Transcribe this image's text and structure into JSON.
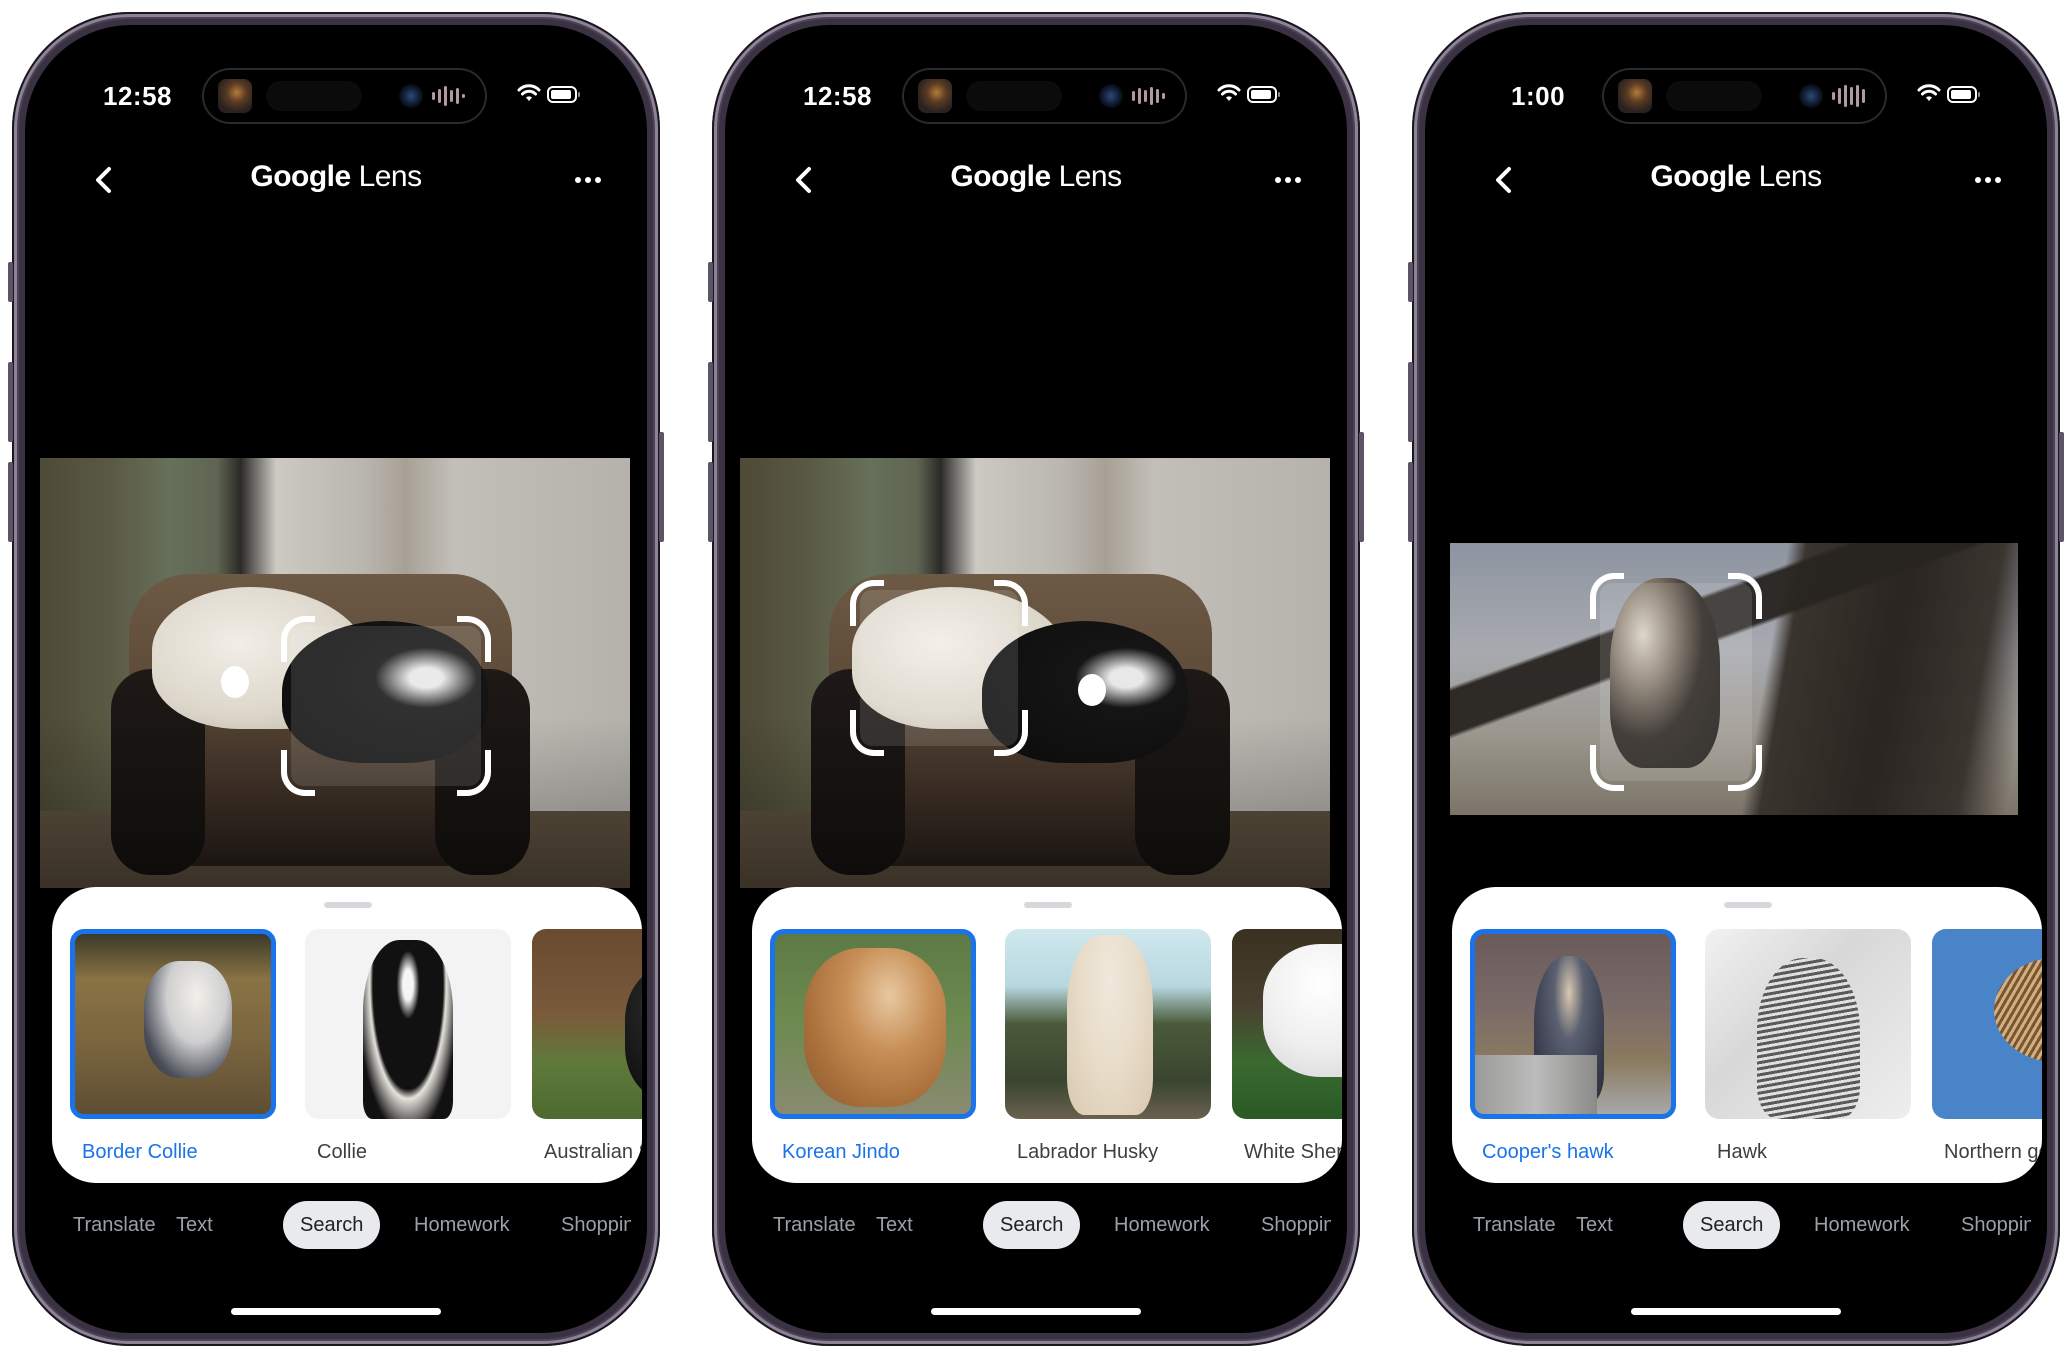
{
  "phones": [
    {
      "status": {
        "time": "12:58"
      },
      "header": {
        "title_google": "Google",
        "title_lens": "Lens",
        "back_icon": "chevron-left-icon",
        "more_icon": "more-horizontal-icon"
      },
      "photo": {
        "subject": "two dogs on a couch",
        "selected_object": "black and white dog"
      },
      "results": [
        {
          "label": "Border Collie",
          "selected": true
        },
        {
          "label": "Collie",
          "selected": false
        },
        {
          "label": "Australian Shepherd",
          "selected": false
        }
      ],
      "tabs": [
        "Translate",
        "Text",
        "Search",
        "Homework",
        "Shopping"
      ],
      "active_tab": "Search"
    },
    {
      "status": {
        "time": "12:58"
      },
      "header": {
        "title_google": "Google",
        "title_lens": "Lens",
        "back_icon": "chevron-left-icon",
        "more_icon": "more-horizontal-icon"
      },
      "photo": {
        "subject": "two dogs on a couch",
        "selected_object": "white dog"
      },
      "results": [
        {
          "label": "Korean Jindo",
          "selected": true
        },
        {
          "label": "Labrador Husky",
          "selected": false
        },
        {
          "label": "White Shepherd",
          "selected": false
        }
      ],
      "tabs": [
        "Translate",
        "Text",
        "Search",
        "Homework",
        "Shopping"
      ],
      "active_tab": "Search"
    },
    {
      "status": {
        "time": "1:00"
      },
      "header": {
        "title_google": "Google",
        "title_lens": "Lens",
        "back_icon": "chevron-left-icon",
        "more_icon": "more-horizontal-icon"
      },
      "photo": {
        "subject": "hawk perched in a tree",
        "selected_object": "hawk"
      },
      "results": [
        {
          "label": "Cooper's hawk",
          "selected": true
        },
        {
          "label": "Hawk",
          "selected": false
        },
        {
          "label": "Northern goshawk",
          "selected": false
        }
      ],
      "tabs": [
        "Translate",
        "Text",
        "Search",
        "Homework",
        "Shopping"
      ],
      "active_tab": "Search"
    }
  ],
  "colors": {
    "accent": "#1a73e8",
    "tab_active_bg": "#e8eaed",
    "tab_inactive": "#9aa0a6",
    "frame": "#3a3242"
  }
}
